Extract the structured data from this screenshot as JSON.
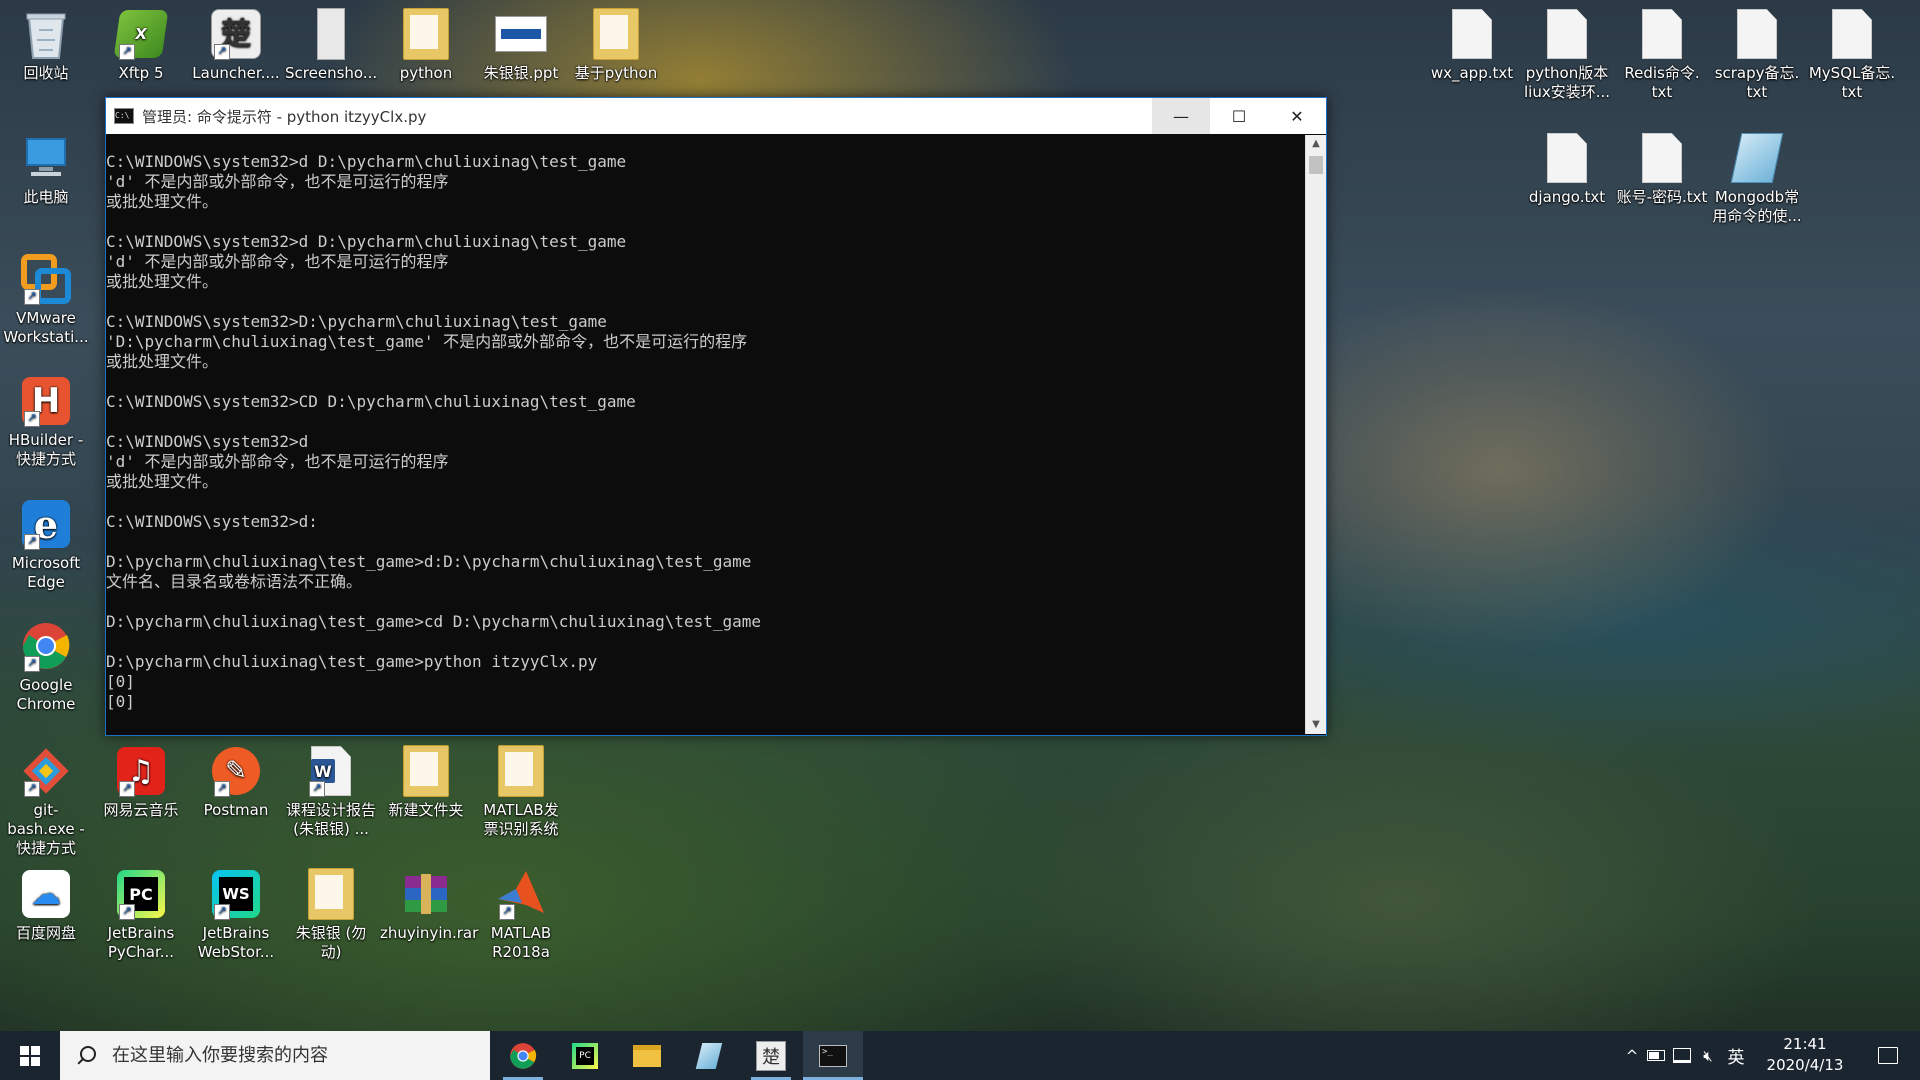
{
  "desktop": {
    "left_icons": [
      {
        "label": "回收站",
        "icon": "recycle-bin-icon"
      },
      {
        "label": "Xftp 5",
        "icon": "xftp-icon"
      },
      {
        "label": "Launcher....",
        "icon": "launcher-icon"
      },
      {
        "label": "Screensho...",
        "icon": "screenshot-icon"
      },
      {
        "label": "python",
        "icon": "word-doc-icon"
      },
      {
        "label": "朱银银.ppt",
        "icon": "ppt-icon"
      },
      {
        "label": "基于python",
        "icon": "folder-icon"
      },
      {
        "label": "此电脑",
        "icon": "computer-icon"
      },
      {
        "label": "VMware Workstati...",
        "icon": "vmware-icon"
      },
      {
        "label": "HBuilder - 快捷方式",
        "icon": "hbuilder-icon"
      },
      {
        "label": "Microsoft Edge",
        "icon": "edge-icon"
      },
      {
        "label": "Google Chrome",
        "icon": "chrome-icon"
      },
      {
        "label": "git-bash.exe - 快捷方式",
        "icon": "git-bash-icon"
      },
      {
        "label": "网易云音乐",
        "icon": "netease-music-icon"
      },
      {
        "label": "Postman",
        "icon": "postman-icon"
      },
      {
        "label": "课程设计报告 (朱银银) ...",
        "icon": "word-doc-icon"
      },
      {
        "label": "新建文件夹",
        "icon": "folder-icon"
      },
      {
        "label": "MATLAB发 票识别系统",
        "icon": "folder-icon"
      },
      {
        "label": "百度网盘",
        "icon": "baidu-netdisk-icon"
      },
      {
        "label": "JetBrains PyChar...",
        "icon": "pycharm-icon"
      },
      {
        "label": "JetBrains WebStor...",
        "icon": "webstorm-icon"
      },
      {
        "label": "朱银银 (勿 动)",
        "icon": "folder-icon"
      },
      {
        "label": "zhuyinyin.rar",
        "icon": "winrar-icon"
      },
      {
        "label": "MATLAB R2018a",
        "icon": "matlab-icon"
      }
    ],
    "right_icons": [
      {
        "label": "wx_app.txt",
        "icon": "text-file-icon"
      },
      {
        "label": "python版本 liux安装环...",
        "icon": "text-file-icon"
      },
      {
        "label": "Redis命令. txt",
        "icon": "text-file-icon"
      },
      {
        "label": "scrapy备忘. txt",
        "icon": "text-file-icon"
      },
      {
        "label": "MySQL备忘. txt",
        "icon": "text-file-icon"
      },
      {
        "label": "django.txt",
        "icon": "text-file-icon"
      },
      {
        "label": "账号-密码.txt",
        "icon": "text-file-icon"
      },
      {
        "label": "Mongodb常 用命令的使...",
        "icon": "notepad-doc-icon"
      }
    ]
  },
  "cmd": {
    "title": "管理员: 命令提示符 - python  itzyyClx.py",
    "minimize_symbol": "—",
    "maximize_symbol": "☐",
    "close_symbol": "✕",
    "lines": [
      "C:\\WINDOWS\\system32>d D:\\pycharm\\chuliuxinag\\test_game",
      "'d' 不是内部或外部命令，也不是可运行的程序",
      "或批处理文件。",
      "",
      "C:\\WINDOWS\\system32>d D:\\pycharm\\chuliuxinag\\test_game",
      "'d' 不是内部或外部命令，也不是可运行的程序",
      "或批处理文件。",
      "",
      "C:\\WINDOWS\\system32>D:\\pycharm\\chuliuxinag\\test_game",
      "'D:\\pycharm\\chuliuxinag\\test_game' 不是内部或外部命令，也不是可运行的程序",
      "或批处理文件。",
      "",
      "C:\\WINDOWS\\system32>CD D:\\pycharm\\chuliuxinag\\test_game",
      "",
      "C:\\WINDOWS\\system32>d",
      "'d' 不是内部或外部命令，也不是可运行的程序",
      "或批处理文件。",
      "",
      "C:\\WINDOWS\\system32>d:",
      "",
      "D:\\pycharm\\chuliuxinag\\test_game>d:D:\\pycharm\\chuliuxinag\\test_game",
      "文件名、目录名或卷标语法不正确。",
      "",
      "D:\\pycharm\\chuliuxinag\\test_game>cd D:\\pycharm\\chuliuxinag\\test_game",
      "",
      "D:\\pycharm\\chuliuxinag\\test_game>python itzyyClx.py",
      "[0]",
      "[0]"
    ]
  },
  "taskbar": {
    "search_placeholder": "在这里输入你要搜索的内容",
    "apps": [
      {
        "name": "chrome-icon"
      },
      {
        "name": "pycharm-icon"
      },
      {
        "name": "file-explorer-icon"
      },
      {
        "name": "notepad-icon"
      },
      {
        "name": "launcher-icon"
      },
      {
        "name": "cmd-icon"
      }
    ],
    "tray": {
      "chevron": "^",
      "ime": "英",
      "time": "21:41",
      "date": "2020/4/13"
    }
  },
  "colors": {
    "cmd_text": "#cccccc",
    "cmd_bg": "#0c0c0c",
    "taskbar_bg": "#1b2530",
    "active_indicator": "#7eb0de"
  }
}
